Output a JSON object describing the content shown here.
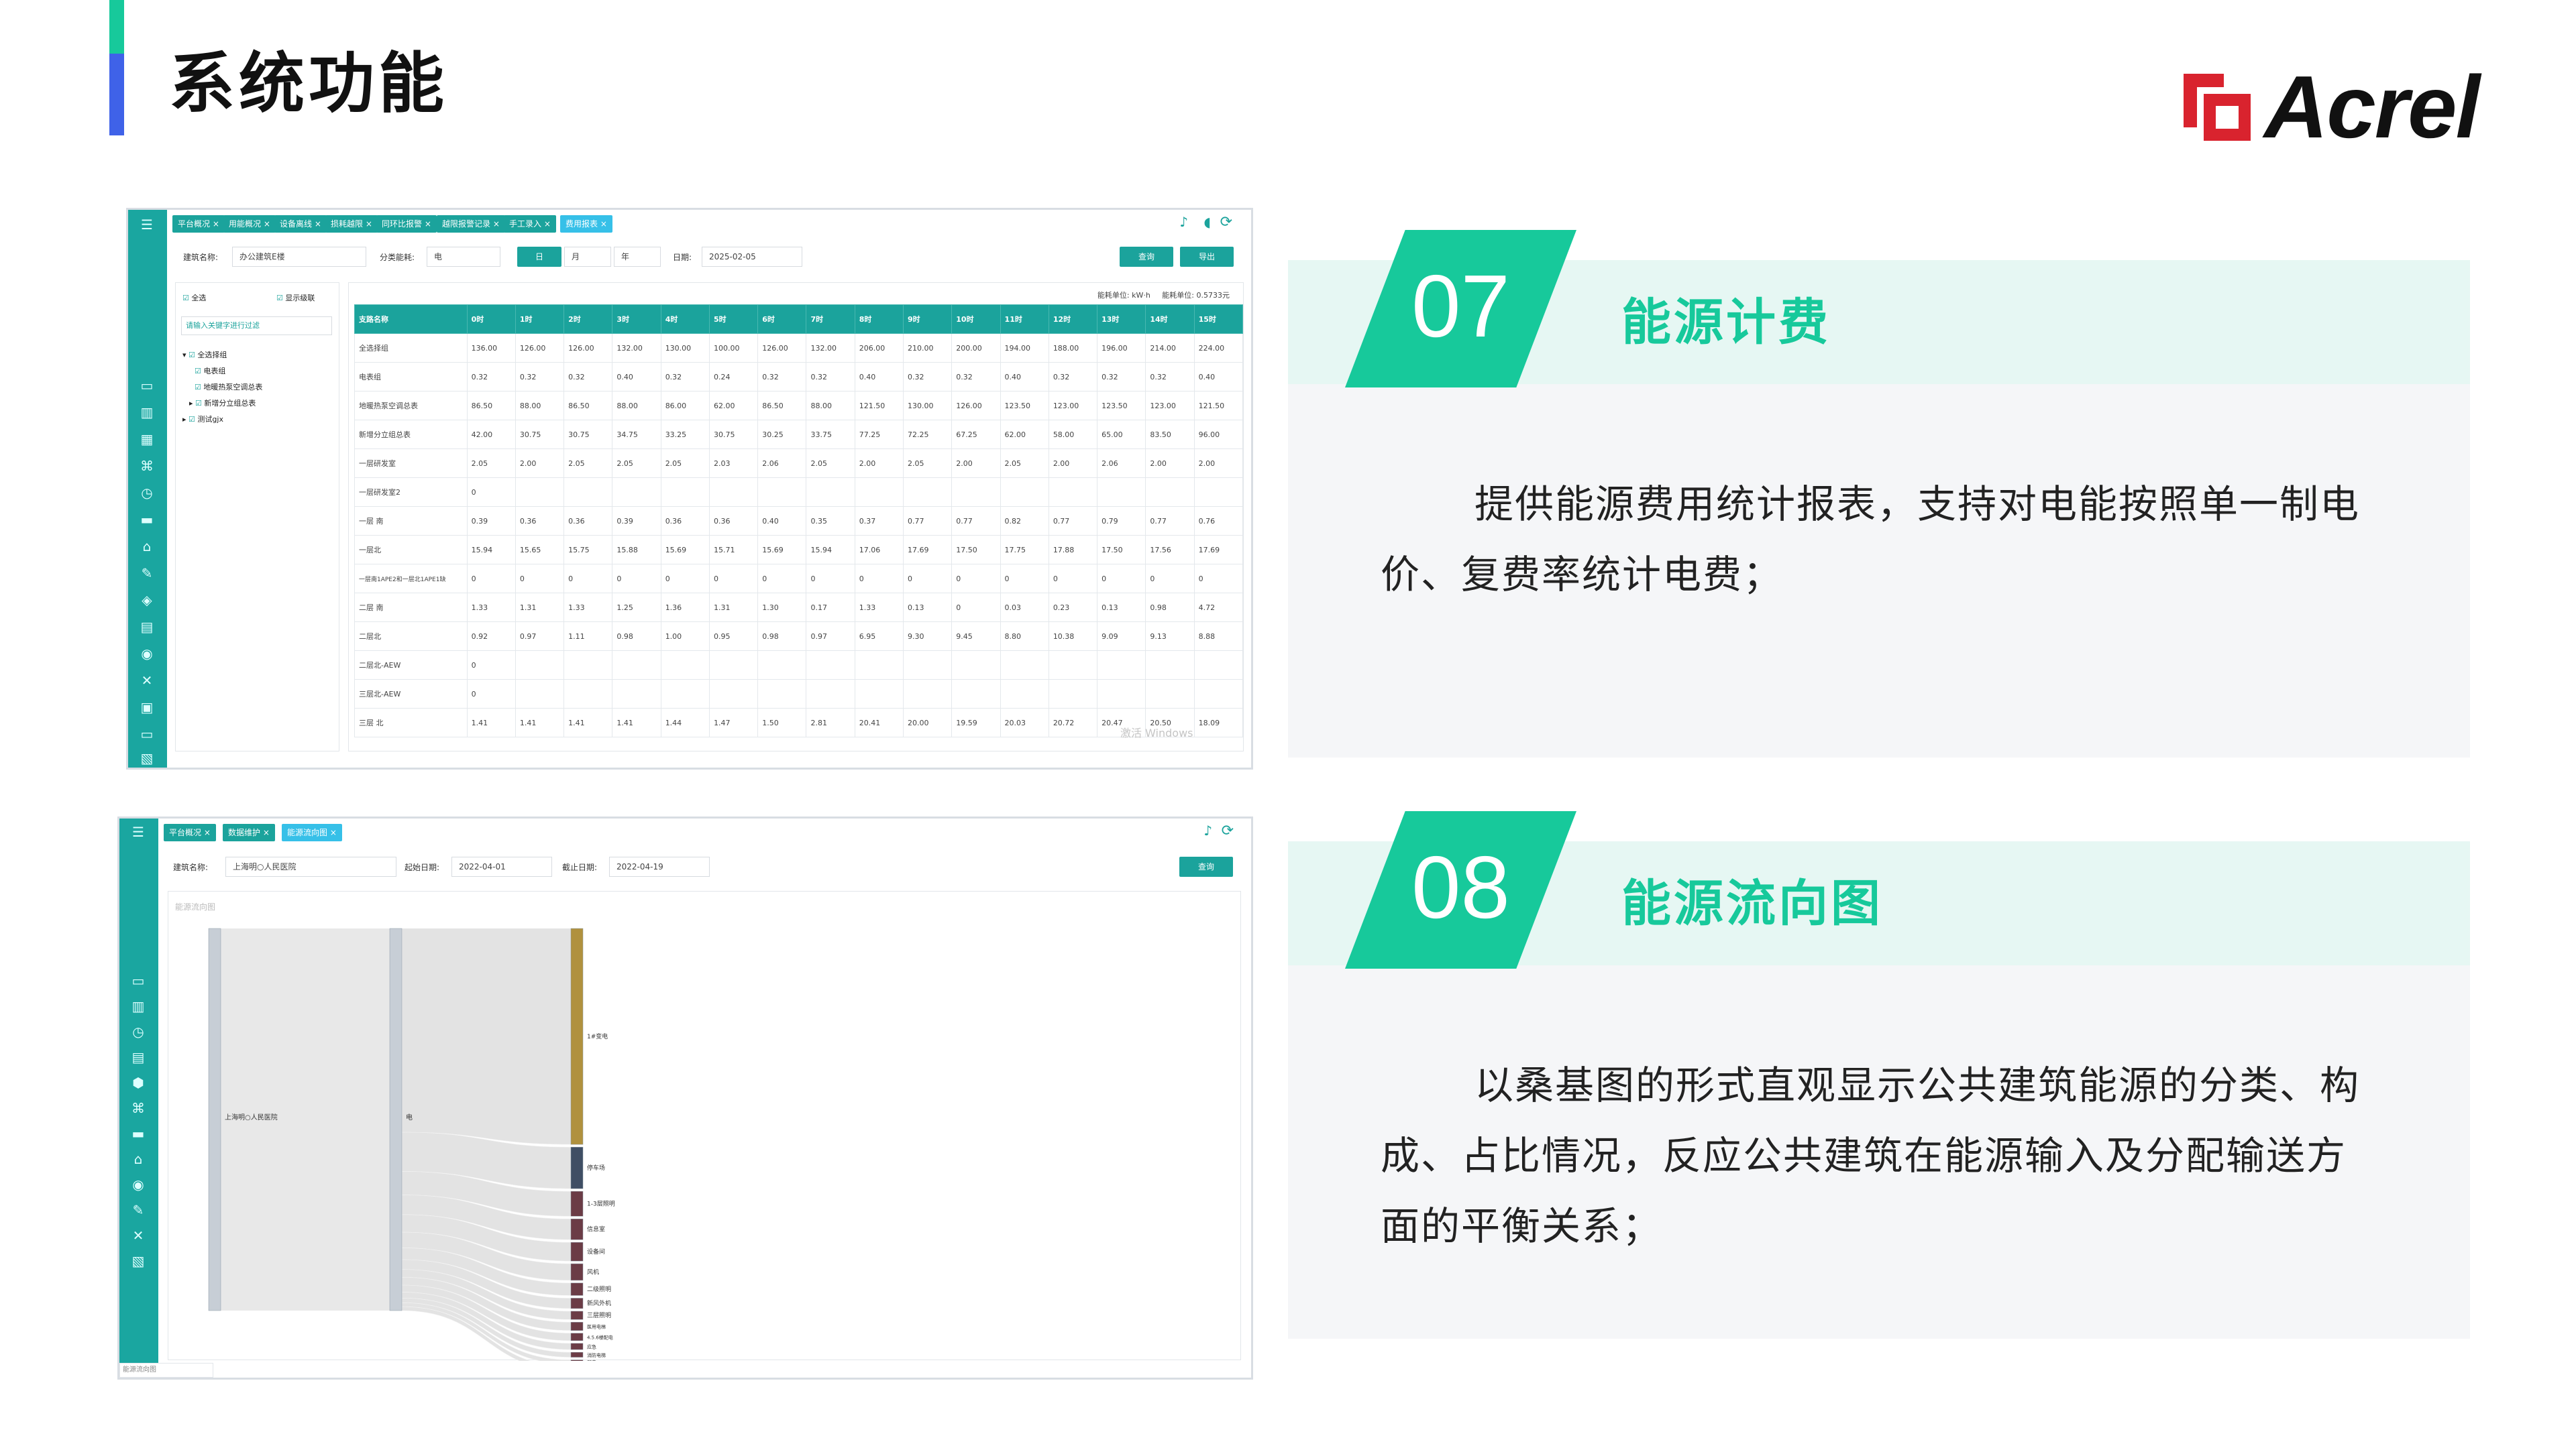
{
  "page": {
    "title": "系统功能",
    "logo_text": "Acrel"
  },
  "colors": {
    "accent_green": "#17c99b",
    "accent_blue": "#3f62e8",
    "app_teal": "#1ba39c",
    "active_tab": "#36c0e8",
    "sankey_gold": "#b0913e",
    "sankey_dark": "#6b3c46"
  },
  "shot1": {
    "tabs": [
      "平台概况 ×",
      "用能概况 ×",
      "设备离线 ×",
      "损耗越限 ×",
      "同环比报警 ×",
      "越限报警记录 ×",
      "手工录入 ×",
      "费用报表 ×"
    ],
    "building_label": "建筑名称:",
    "building_value": "办公建筑E楼",
    "category_label": "分类能耗:",
    "category_value": "电",
    "date_label": "日期:",
    "date_value": "2025-02-05",
    "mode_day": "日",
    "mode_month": "月",
    "mode_year": "年",
    "query_btn": "查询",
    "export_btn": "导出",
    "select_all": "全选",
    "cascade": "显示级联",
    "filter_placeholder": "请输入关键字进行过滤",
    "tree": [
      "全选择组",
      "电表组",
      "地暖热泵空调总表",
      "新增分立组总表",
      "测试gjx"
    ],
    "unit_note": "能耗单位: kW·h     能耗单位: 0.5733元",
    "table": {
      "headers": [
        "支路名称",
        "0时",
        "1时",
        "2时",
        "3时",
        "4时",
        "5时",
        "6时",
        "7时",
        "8时",
        "9时",
        "10时",
        "11时",
        "12时",
        "13时",
        "14时",
        "15时"
      ],
      "rows": [
        [
          "全选择组",
          "136.00",
          "126.00",
          "126.00",
          "132.00",
          "130.00",
          "100.00",
          "126.00",
          "132.00",
          "206.00",
          "210.00",
          "200.00",
          "194.00",
          "188.00",
          "196.00",
          "214.00",
          "224.00"
        ],
        [
          "电表组",
          "0.32",
          "0.32",
          "0.32",
          "0.40",
          "0.32",
          "0.24",
          "0.32",
          "0.32",
          "0.40",
          "0.32",
          "0.32",
          "0.40",
          "0.32",
          "0.32",
          "0.32",
          "0.40"
        ],
        [
          "地暖热泵空调总表",
          "86.50",
          "88.00",
          "86.50",
          "88.00",
          "86.00",
          "62.00",
          "86.50",
          "88.00",
          "121.50",
          "130.00",
          "126.00",
          "123.50",
          "123.00",
          "123.50",
          "123.00",
          "121.50"
        ],
        [
          "新增分立组总表",
          "42.00",
          "30.75",
          "30.75",
          "34.75",
          "33.25",
          "30.75",
          "30.25",
          "33.75",
          "77.25",
          "72.25",
          "67.25",
          "62.00",
          "58.00",
          "65.00",
          "83.50",
          "96.00"
        ],
        [
          "一层研发室",
          "2.05",
          "2.00",
          "2.05",
          "2.05",
          "2.05",
          "2.03",
          "2.06",
          "2.05",
          "2.00",
          "2.05",
          "2.00",
          "2.05",
          "2.00",
          "2.06",
          "2.00",
          "2.00"
        ],
        [
          "一层研发室2",
          "0",
          "",
          "",
          "",
          "",
          "",
          "",
          "",
          "",
          "",
          "",
          "",
          "",
          "",
          "",
          ""
        ],
        [
          "一层 南",
          "0.39",
          "0.36",
          "0.36",
          "0.39",
          "0.36",
          "0.36",
          "0.40",
          "0.35",
          "0.37",
          "0.77",
          "0.77",
          "0.82",
          "0.77",
          "0.79",
          "0.77",
          "0.76"
        ],
        [
          "一层北",
          "15.94",
          "15.65",
          "15.75",
          "15.88",
          "15.69",
          "15.71",
          "15.69",
          "15.94",
          "17.06",
          "17.69",
          "17.50",
          "17.75",
          "17.88",
          "17.50",
          "17.56",
          "17.69"
        ],
        [
          "一层南1APE2和一层北1APE1缺",
          "0",
          "0",
          "0",
          "0",
          "0",
          "0",
          "0",
          "0",
          "0",
          "0",
          "0",
          "0",
          "0",
          "0",
          "0",
          "0"
        ],
        [
          "二层 南",
          "1.33",
          "1.31",
          "1.33",
          "1.25",
          "1.36",
          "1.31",
          "1.30",
          "0.17",
          "1.33",
          "0.13",
          "0",
          "0.03",
          "0.23",
          "0.13",
          "0.98",
          "4.72"
        ],
        [
          "二层北",
          "0.92",
          "0.97",
          "1.11",
          "0.98",
          "1.00",
          "0.95",
          "0.98",
          "0.97",
          "6.95",
          "9.30",
          "9.45",
          "8.80",
          "10.38",
          "9.09",
          "9.13",
          "8.88"
        ],
        [
          "二层北-AEW",
          "0",
          "",
          "",
          "",
          "",
          "",
          "",
          "",
          "",
          "",
          "",
          "",
          "",
          "",
          "",
          ""
        ],
        [
          "三层北-AEW",
          "0",
          "",
          "",
          "",
          "",
          "",
          "",
          "",
          "",
          "",
          "",
          "",
          "",
          "",
          "",
          ""
        ],
        [
          "三层 北",
          "1.41",
          "1.41",
          "1.41",
          "1.41",
          "1.44",
          "1.47",
          "1.50",
          "2.81",
          "20.41",
          "20.00",
          "19.59",
          "20.03",
          "20.72",
          "20.47",
          "20.50",
          "18.09"
        ]
      ]
    },
    "watermark": "激活 Windows"
  },
  "shot2": {
    "tabs": [
      "平台概况 ×",
      "数据维护 ×",
      "能源流向图 ×"
    ],
    "building_label": "建筑名称:",
    "building_value": "上海明○人民医院",
    "start_label": "起始日期:",
    "start_value": "2022-04-01",
    "end_label": "截止日期:",
    "end_value": "2022-04-19",
    "query_btn": "查询",
    "chart_title": "能源流向图",
    "footer_note": "能源流向图",
    "sankey": {
      "source": "上海明○人民医院",
      "mid": "电",
      "targets": [
        {
          "name": "1#变电",
          "share": 0.52
        },
        {
          "name": "停车场",
          "share": 0.1
        },
        {
          "name": "1-3层照明",
          "share": 0.06
        },
        {
          "name": "信息室",
          "share": 0.05
        },
        {
          "name": "设备间",
          "share": 0.045
        },
        {
          "name": "风机",
          "share": 0.04
        },
        {
          "name": "二级照明",
          "share": 0.03
        },
        {
          "name": "新风外机",
          "share": 0.025
        },
        {
          "name": "三层照明",
          "share": 0.02
        },
        {
          "name": "医用电梯",
          "share": 0.02
        },
        {
          "name": "4.5.6楼配电",
          "share": 0.018
        },
        {
          "name": "应急",
          "share": 0.015
        },
        {
          "name": "消防电梯",
          "share": 0.012
        },
        {
          "name": "弱电",
          "share": 0.01
        },
        {
          "name": "污水电机",
          "share": 0.01
        }
      ]
    }
  },
  "cards": [
    {
      "num": "07",
      "title": "能源计费",
      "desc": "提供能源费用统计报表，支持对电能按照单一制电价、复费率统计电费；"
    },
    {
      "num": "08",
      "title": "能源流向图",
      "desc": "以桑基图的形式直观显示公共建筑能源的分类、构成、占比情况，反应公共建筑在能源输入及分配输送方面的平衡关系；"
    }
  ]
}
